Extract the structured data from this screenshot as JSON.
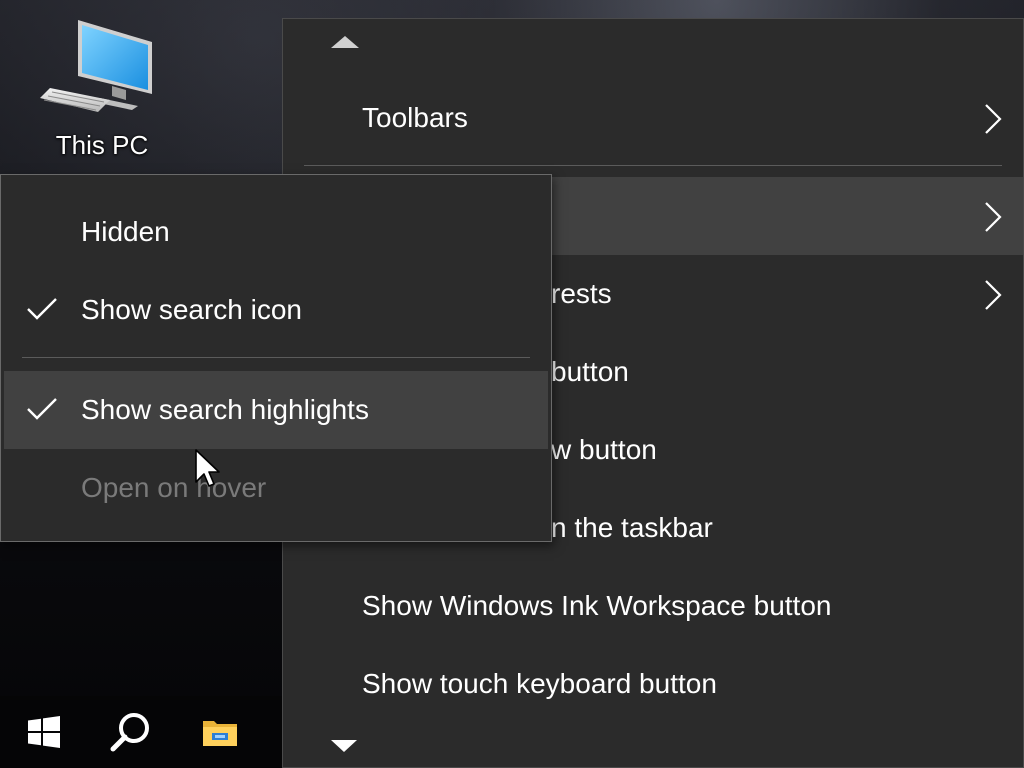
{
  "desktop": {
    "icons": [
      {
        "label": "This PC",
        "icon": "this-pc-icon"
      }
    ]
  },
  "taskbar": {
    "buttons": [
      {
        "name": "start",
        "icon": "windows-logo-icon"
      },
      {
        "name": "search",
        "icon": "search-icon"
      },
      {
        "name": "file-explorer",
        "icon": "folder-icon"
      }
    ]
  },
  "context_menu": {
    "items": [
      {
        "label": "Toolbars",
        "has_submenu": true
      },
      {
        "label": "",
        "has_submenu": true,
        "highlighted": true
      },
      {
        "label": "rests",
        "has_submenu": true
      },
      {
        "label": "button"
      },
      {
        "label": "w button"
      },
      {
        "label": "n the taskbar"
      },
      {
        "label": "Show Windows Ink Workspace button"
      },
      {
        "label": "Show touch keyboard button"
      }
    ],
    "scroll_up_icon": "triangle-up-icon",
    "scroll_down_icon": "triangle-down-icon"
  },
  "submenu": {
    "items": [
      {
        "label": "Hidden",
        "checked": false
      },
      {
        "label": "Show search icon",
        "checked": true
      },
      {
        "label": "Show search highlights",
        "checked": true,
        "highlighted": true
      },
      {
        "label": "Open on hover",
        "checked": false,
        "disabled": true
      }
    ]
  },
  "colors": {
    "menu_background": "#2b2b2b",
    "menu_highlight": "#414141",
    "disabled_text": "#7a7a7a",
    "separator": "#5b5b5b"
  }
}
